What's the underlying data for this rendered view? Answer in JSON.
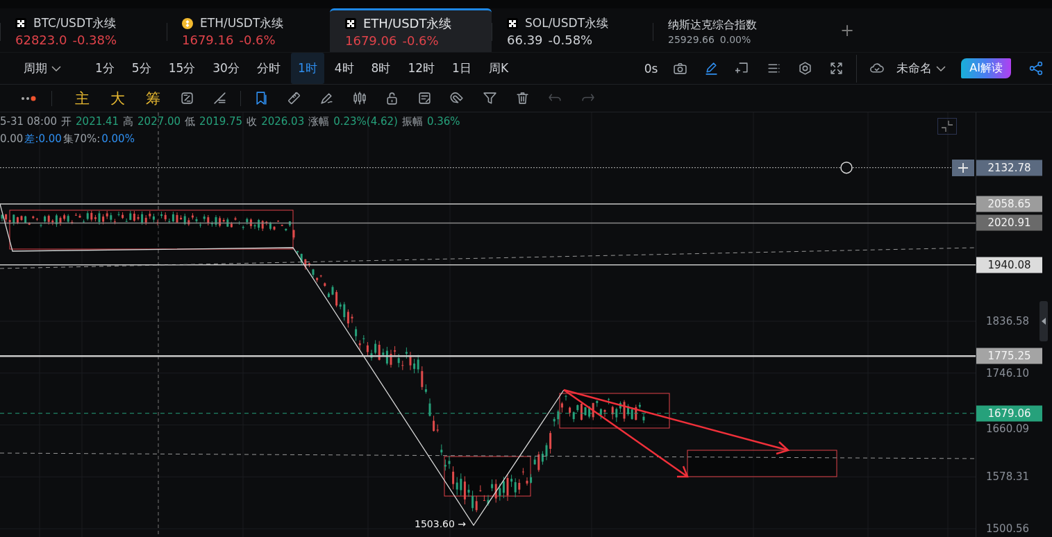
{
  "tabs": [
    {
      "kind": "grid",
      "symbol": "BTC/USDT永续",
      "price": "62823.0",
      "change": "-0.38%",
      "color": "#e0434a",
      "selected": false
    },
    {
      "kind": "coin",
      "symbol": "ETH/USDT永续",
      "price": "1679.16",
      "change": "-0.6%",
      "color": "#e0434a",
      "selected": false
    },
    {
      "kind": "grid",
      "symbol": "ETH/USDT永续",
      "price": "1679.06",
      "change": "-0.6%",
      "color": "#e0434a",
      "selected": true
    },
    {
      "kind": "grid",
      "symbol": "SOL/USDT永续",
      "price": "66.39",
      "change": "-0.58%",
      "color": "#cfd2d6",
      "selected": false
    },
    {
      "kind": "index",
      "symbol": "纳斯达克综合指数",
      "price": "25929.66",
      "change": "0.00%",
      "color": "#9aa0a6",
      "selected": false
    }
  ],
  "add_tab": "+",
  "period_menu": {
    "label": "周期"
  },
  "intervals": [
    {
      "label": "1分",
      "selected": false
    },
    {
      "label": "5分",
      "selected": false
    },
    {
      "label": "15分",
      "selected": false
    },
    {
      "label": "30分",
      "selected": false
    },
    {
      "label": "分时",
      "selected": false
    },
    {
      "label": "1时",
      "selected": true
    },
    {
      "label": "4时",
      "selected": false
    },
    {
      "label": "8时",
      "selected": false
    },
    {
      "label": "12时",
      "selected": false
    },
    {
      "label": "1日",
      "selected": false
    },
    {
      "label": "周K",
      "selected": false
    }
  ],
  "toolbar": {
    "countdown": "0s",
    "layout_name": "未命名",
    "ai_button": "AI解读"
  },
  "indicator_tabs": [
    "主",
    "大",
    "筹"
  ],
  "legend": {
    "time": "5-31 08:00",
    "fields": [
      {
        "label": "开",
        "value": "2021.41"
      },
      {
        "label": "高",
        "value": "2027.00"
      },
      {
        "label": "低",
        "value": "2019.75"
      },
      {
        "label": "收",
        "value": "2026.03"
      },
      {
        "label": "涨幅",
        "value": "0.23%(4.62)"
      },
      {
        "label": "振幅",
        "value": "0.36%"
      }
    ],
    "line2": [
      {
        "kind": "label",
        "text": "0.00"
      },
      {
        "kind": "value",
        "text": "差:0.00"
      },
      {
        "kind": "label",
        "text": "集70%:"
      },
      {
        "kind": "value",
        "text": "0.00%"
      }
    ]
  },
  "price_axis": {
    "ticks": [
      "1836.58",
      "1746.10",
      "1660.09",
      "1578.31",
      "1500.56"
    ],
    "tags": [
      {
        "value": "2132.78",
        "kind": "cursor",
        "color": "#5b6a80"
      },
      {
        "value": "2058.65",
        "kind": "line",
        "color": "#9c9c9c"
      },
      {
        "value": "2020.91",
        "kind": "line",
        "color": "#6a6a6a"
      },
      {
        "value": "1940.08",
        "kind": "line",
        "color": "#dcdcdc"
      },
      {
        "value": "1775.25",
        "kind": "line",
        "color": "#a4a4a4"
      },
      {
        "value": "1679.06",
        "kind": "last",
        "color": "#26a17b"
      }
    ]
  },
  "annotations": {
    "low_label": "1503.60 →"
  }
}
